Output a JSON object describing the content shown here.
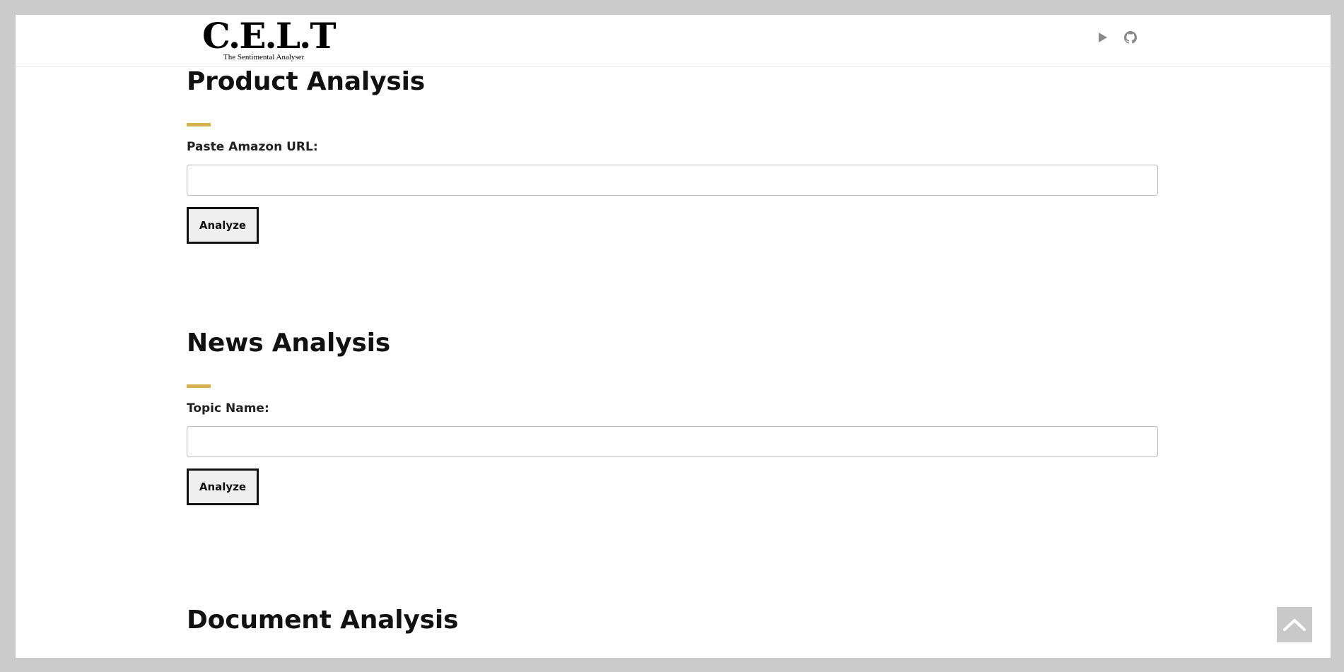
{
  "header": {
    "logo_title": "C.E.L.T",
    "logo_subtitle": "The Sentimental Analyser",
    "icons": [
      "play-icon",
      "github-icon"
    ]
  },
  "product": {
    "title": "Product Analysis",
    "label": "Paste Amazon URL:",
    "input_value": "",
    "button_label": "Analyze"
  },
  "news": {
    "title": "News Analysis",
    "label": "Topic Name:",
    "input_value": "",
    "button_label": "Analyze"
  },
  "document": {
    "title": "Document Analysis"
  },
  "colors": {
    "accent": "#d4b04e",
    "page_bg": "#ffffff",
    "frame_bg": "#cbcbcb",
    "icon_gray": "#8a8a8a"
  }
}
